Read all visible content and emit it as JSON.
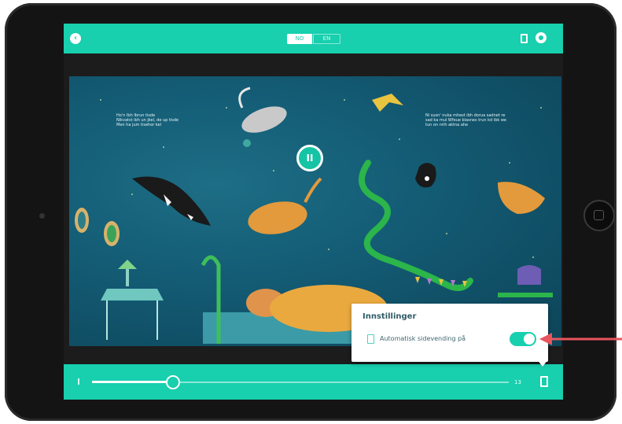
{
  "header": {
    "back_icon": "back-arrow-icon",
    "segment_left": "NO",
    "segment_right": "EN",
    "bookmark_icon": "bookmark-icon",
    "settings_icon": "gear-icon"
  },
  "page": {
    "left_text": "Ho'n Ibh Ibrun tisde\nNikvatst ibh un jkel, de up tisde\nMen ha jum tisehor kel",
    "right_text": "Ni susn' nuka mhest ibh dorua sadnet re\nsad ka mul Wfeue biasnes trun kd ibk we\ntun on nrih aktna ahe"
  },
  "player": {
    "play_label": "II",
    "progress": 0.19,
    "page_counter": "13"
  },
  "settings_popup": {
    "title": "Innstillinger",
    "option_label": "Automatisk sidevending på",
    "toggle_on": true
  },
  "colors": {
    "accent": "#18cfae",
    "arrow": "#e8555c"
  }
}
